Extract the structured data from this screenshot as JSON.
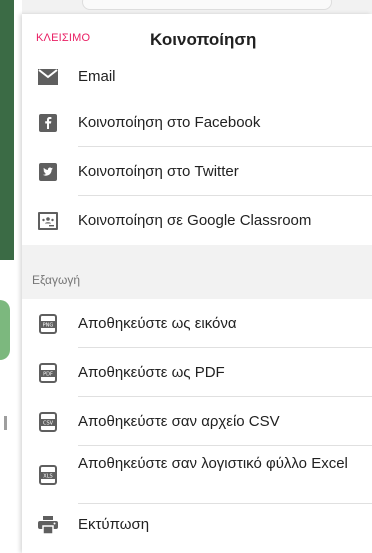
{
  "header": {
    "close_label": "ΚΛΕΙΣΙΜΟ",
    "title": "Κοινοποίηση"
  },
  "share_items": [
    {
      "label": "Email",
      "icon": "email-icon"
    },
    {
      "label": "Κοινοποίηση στο Facebook",
      "icon": "facebook-icon"
    },
    {
      "label": "Κοινοποίηση στο Twitter",
      "icon": "twitter-icon"
    },
    {
      "label": "Κοινοποίηση σε Google Classroom",
      "icon": "google-classroom-icon"
    }
  ],
  "export_section": {
    "title": "Εξαγωγή",
    "items": [
      {
        "label": "Αποθηκεύστε ως εικόνα",
        "icon": "png-file-icon",
        "badge": "PNG"
      },
      {
        "label": "Αποθηκεύστε ως PDF",
        "icon": "pdf-file-icon",
        "badge": "PDF"
      },
      {
        "label": "Αποθηκεύστε σαν αρχείο CSV",
        "icon": "csv-file-icon",
        "badge": "CSV"
      },
      {
        "label": "Αποθηκεύστε σαν λογιστικό φύλλο Excel",
        "icon": "xls-file-icon",
        "badge": "XLS"
      },
      {
        "label": "Εκτύπωση",
        "icon": "print-icon"
      }
    ]
  },
  "colors": {
    "accent": "#e91e63",
    "icon": "#5f5f5f",
    "section_bg": "#f2f2f2"
  }
}
